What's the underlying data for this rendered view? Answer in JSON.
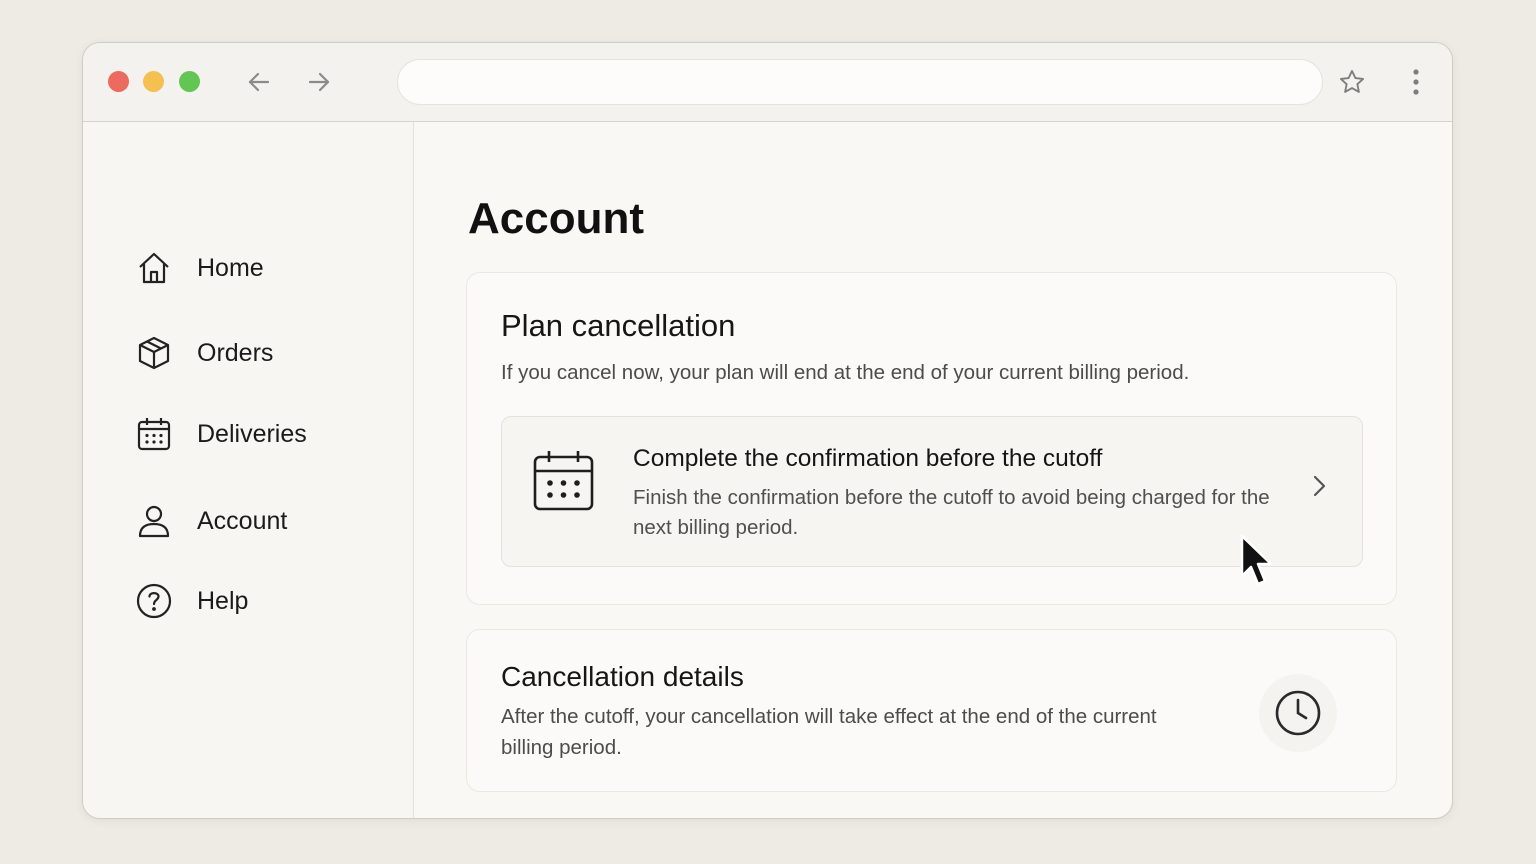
{
  "browser": {
    "address": ""
  },
  "sidebar": {
    "items": [
      {
        "label": "Home",
        "icon": "home-icon"
      },
      {
        "label": "Orders",
        "icon": "package-icon"
      },
      {
        "label": "Deliveries",
        "icon": "calendar-icon"
      },
      {
        "label": "Account",
        "icon": "user-icon"
      },
      {
        "label": "Help",
        "icon": "help-circle-icon"
      }
    ]
  },
  "main": {
    "title": "Account",
    "plan_card": {
      "title": "Plan cancellation",
      "description": "If you cancel now, your plan will end at the end of your current billing period.",
      "action": {
        "title": "Complete the confirmation before the cutoff",
        "description": "Finish the confirmation before the cutoff to avoid being charged for the next billing period.",
        "icon": "calendar-icon"
      }
    },
    "details_card": {
      "title": "Cancellation details",
      "description": "After the cutoff, your cancellation will take effect at the end of the current billing period.",
      "icon": "clock-icon"
    }
  },
  "colors": {
    "traffic_red": "#ec6a5e",
    "traffic_yellow": "#f4c04f",
    "traffic_green": "#62c554",
    "background": "#edebe3"
  }
}
